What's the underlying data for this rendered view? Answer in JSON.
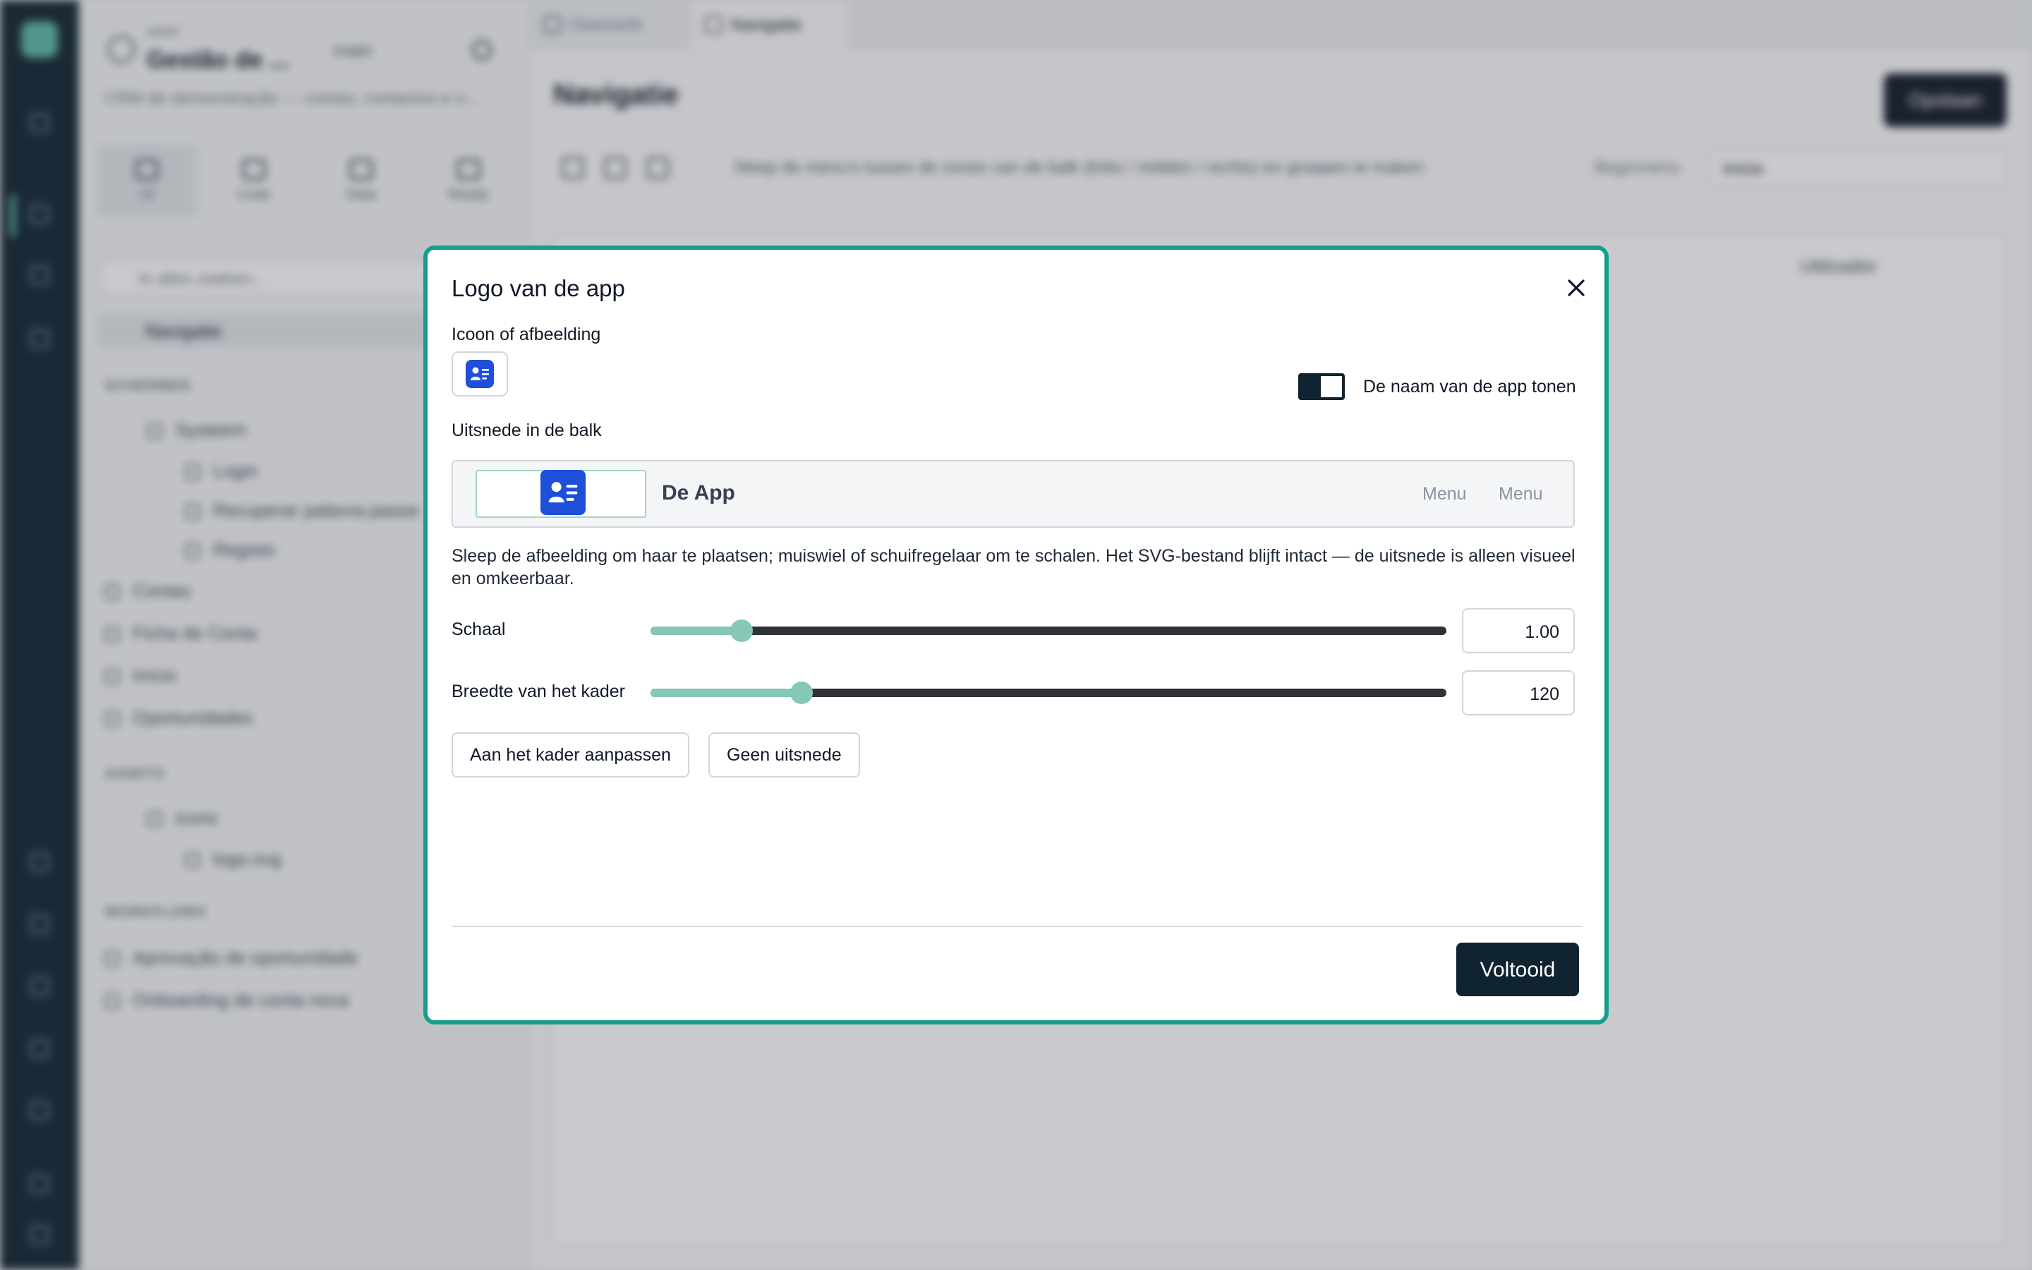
{
  "background": {
    "project": {
      "subtitle": "AIRIP",
      "name": "Gestão de ...",
      "branch": "main",
      "description": "CRM de demonstração — contas, contactos e o..."
    },
    "modes": [
      {
        "label": "UI",
        "icon": "layout-icon"
      },
      {
        "label": "Code",
        "icon": "code-icon"
      },
      {
        "label": "Data",
        "icon": "database-icon"
      },
      {
        "label": "Ready",
        "icon": "rocket-icon"
      }
    ],
    "search_placeholder": "In alles zoeken...",
    "nav_selected": "Navigatie",
    "sections": {
      "screens": "SCHERMEN",
      "assets": "ASSETS",
      "workflows": "WORKFLOWS"
    },
    "screens": [
      "Systeem",
      "Login",
      "Recuperar palavra-passe",
      "Registo",
      "Contas",
      "Ficha de Conta",
      "Início",
      "Oportunidades"
    ],
    "assets": [
      "icons",
      "logo.svg"
    ],
    "workflows": [
      "Aprovação de oportunidade",
      "Onboarding de conta nova"
    ],
    "tabs": [
      "Overzicht",
      "Navigatie"
    ],
    "page_title": "Navigatie",
    "publish_label": "Opslaan",
    "toolbar_hint": "Sleep de menu's tussen de zones van de balk (links / midden / rechts) en groepen te maken.",
    "start_label": "Beginmenu",
    "start_value": "Início",
    "user_label": "Utilizador"
  },
  "modal": {
    "title": "Logo van de app",
    "icon_label": "Icoon of afbeelding",
    "show_name_label": "De naam van de app tonen",
    "show_name_on": false,
    "crop_label": "Uitsnede in de balk",
    "preview": {
      "app_name": "De App",
      "menu_items": [
        "Menu",
        "Menu"
      ]
    },
    "help_text": "Sleep de afbeelding om haar te plaatsen; muiswiel of schuifregelaar om te schalen. Het SVG-bestand blijft intact — de uitsnede is alleen visueel en omkeerbaar.",
    "scale": {
      "label": "Schaal",
      "value": "1.00",
      "fraction": 0.114
    },
    "frame_width": {
      "label": "Breedte van het kader",
      "value": "120",
      "fraction": 0.19
    },
    "fit_button": "Aan het kader aanpassen",
    "no_crop_button": "Geen uitsnede",
    "done_button": "Voltooid"
  },
  "colors": {
    "accent": "#159e8c",
    "slider_fill": "#86c7b8",
    "app_tile": "#1d4fd8",
    "primary_button": "#0f2430"
  }
}
